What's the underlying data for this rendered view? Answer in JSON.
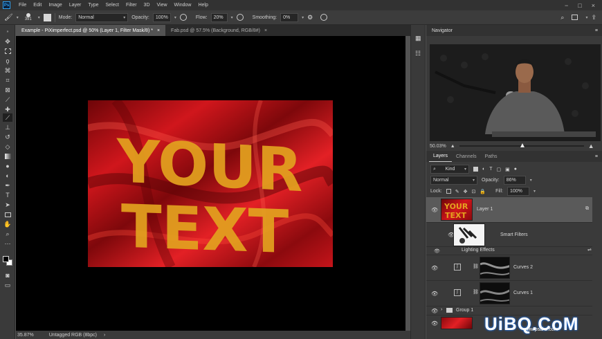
{
  "app": {
    "logo": "Ps",
    "menus": [
      "File",
      "Edit",
      "Image",
      "Layer",
      "Type",
      "Select",
      "Filter",
      "3D",
      "View",
      "Window",
      "Help"
    ]
  },
  "options": {
    "brush_size": "391",
    "mode_label": "Mode:",
    "mode_value": "Normal",
    "opacity_label": "Opacity:",
    "opacity_value": "100%",
    "flow_label": "Flow:",
    "flow_value": "20%",
    "smoothing_label": "Smoothing:",
    "smoothing_value": "0%"
  },
  "tabs": [
    {
      "label": "Example - PiXimperfect.psd @ 50% (Layer 1, Filter Mask/8) *",
      "close": "×"
    },
    {
      "label": "Fab.psd @ 57.5% (Background, RGB/8#)",
      "close": "×"
    }
  ],
  "canvas": {
    "line1": "YOUR",
    "line2": "TEXT"
  },
  "status": {
    "zoom": "35.87%",
    "profile": "Untagged RGB (8bpc)",
    "arrow": "›"
  },
  "navigator": {
    "title": "Navigator",
    "zoom": "50.03%"
  },
  "layers_panel": {
    "tabs": [
      "Layers",
      "Channels",
      "Paths"
    ],
    "kind_label": "Kind",
    "blend_mode": "Normal",
    "opacity_label": "Opacity:",
    "opacity_value": "86%",
    "lock_label": "Lock:",
    "fill_label": "Fill:",
    "fill_value": "100%",
    "layers": [
      {
        "name": "Layer 1"
      },
      {
        "name": "Smart Filters"
      },
      {
        "name": "Lighting Effects"
      },
      {
        "name": "Curves 2"
      },
      {
        "name": "Curves 1"
      },
      {
        "name": "Group 1"
      }
    ]
  },
  "watermark": {
    "main": "UiBQ.CoM",
    "sub": "www.psahz.com"
  },
  "colors": {
    "accent": "#2fa3f5",
    "text_fill": "#e7a51e",
    "fabric": "#c8151b"
  }
}
